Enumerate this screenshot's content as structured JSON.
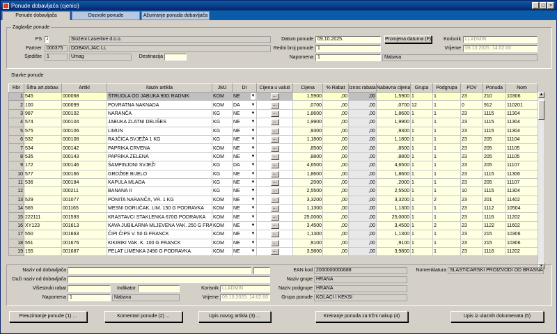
{
  "window": {
    "title": "Ponude dobavljača (cjenici)"
  },
  "tabs": [
    {
      "label": "Ponude dobavljača"
    },
    {
      "label": "Dozvole ponude"
    },
    {
      "label": "Ažuriranje ponuda dobavljača"
    }
  ],
  "header": {
    "section_title": "Zaglavlje ponude",
    "ps_label": "PS",
    "ps_value": "4",
    "ps_name": "Složeni Laserline d.o.o.",
    "partner_label": "Partner",
    "partner_value": "000375",
    "partner_name": "DOBAVLJAČ LL",
    "sjediste_label": "Sjedište",
    "sjediste_value": "1",
    "sjediste_name": "Umag",
    "destinacija_label": "Destinacija",
    "destinacija_value": "",
    "datum_label": "Datum ponude",
    "datum_value": "09.10.2025.",
    "promjena_btn": "Promjena datuma (F)",
    "redni_label": "Redni broj ponude",
    "redni_value": "1",
    "napomena_label": "Napomena",
    "napomena_value": "1",
    "napomena_text": "Nabava",
    "korisnik_label": "Korisnik",
    "korisnik_value": "LLADMIN",
    "vrijeme_label": "Vrijeme",
    "vrijeme_value": "09.10.2025. 14:02:00"
  },
  "stavke": {
    "section_title": "Stavke ponude",
    "columns": [
      "Rbr",
      "Šifra art.dobav.",
      "Artikl",
      "Naziv artikla",
      "JMJ",
      "DI",
      "Cijena u valuti",
      "Cijena",
      "% Rabat",
      "Iznos rabata",
      "Nabavna cijena",
      "Grupa",
      "Podgrupa",
      "PDV",
      "Ponuda",
      "Nom"
    ],
    "rows": [
      {
        "rbr": "1",
        "sifra": "545",
        "artikl": "000068",
        "naziv": "ŠTRUDLA OD JABUKA 90G RADNIK",
        "jmj": "KOM",
        "di": "NE",
        "cijena": "1,5900",
        "rabat": ",00",
        "iznos": ",00",
        "nabavna": "1,5900",
        "grupa": "1",
        "podgrupa": "1",
        "pdv": "23",
        "ponuda": "210",
        "nom": "10306"
      },
      {
        "rbr": "2",
        "sifra": "100",
        "artikl": "000099",
        "naziv": "POVRATNA NAKNADA",
        "jmj": "KOM",
        "di": "DA",
        "cijena": ",0700",
        "rabat": ",00",
        "iznos": ",00",
        "nabavna": ",0700",
        "grupa": "12",
        "podgrupa": "1",
        "pdv": "0",
        "ponuda": "912",
        "nom": "110201"
      },
      {
        "rbr": "3",
        "sifra": "987",
        "artikl": "000102",
        "naziv": "NARANČA",
        "jmj": "KG",
        "di": "NE",
        "cijena": "1,8600",
        "rabat": ",00",
        "iznos": ",00",
        "nabavna": "1,8600",
        "grupa": "1",
        "podgrupa": "1",
        "pdv": "23",
        "ponuda": "1115",
        "nom": "11304"
      },
      {
        "rbr": "4",
        "sifra": "574",
        "artikl": "000104",
        "naziv": "JABUKA ZLATNI DELIŠES",
        "jmj": "KG",
        "di": "NE",
        "cijena": "1,9900",
        "rabat": ",00",
        "iznos": ",00",
        "nabavna": "1,9900",
        "grupa": "1",
        "podgrupa": "1",
        "pdv": "23",
        "ponuda": "1115",
        "nom": "11304"
      },
      {
        "rbr": "5",
        "sifra": "575",
        "artikl": "000106",
        "naziv": "LIMUN",
        "jmj": "KG",
        "di": "NE",
        "cijena": ",9300",
        "rabat": ",00",
        "iznos": ",00",
        "nabavna": ",9300",
        "grupa": "1",
        "podgrupa": "1",
        "pdv": "23",
        "ponuda": "1115",
        "nom": "11304"
      },
      {
        "rbr": "6",
        "sifra": "532",
        "artikl": "000108",
        "naziv": "RAJČICA SVJEŽA 1 KG",
        "jmj": "KG",
        "di": "NE",
        "cijena": "1,1800",
        "rabat": ",00",
        "iznos": ",00",
        "nabavna": "1,1800",
        "grupa": "1",
        "podgrupa": "1",
        "pdv": "23",
        "ponuda": "205",
        "nom": "11104"
      },
      {
        "rbr": "7",
        "sifra": "534",
        "artikl": "000142",
        "naziv": "PAPRIKA CRVENA",
        "jmj": "KOM",
        "di": "NE",
        "cijena": ",8500",
        "rabat": ",00",
        "iznos": ",00",
        "nabavna": ",8500",
        "grupa": "1",
        "podgrupa": "1",
        "pdv": "23",
        "ponuda": "205",
        "nom": "11105"
      },
      {
        "rbr": "8",
        "sifra": "535",
        "artikl": "000143",
        "naziv": "PAPRIKA ZELENA",
        "jmj": "KOM",
        "di": "NE",
        "cijena": ",8800",
        "rabat": ",00",
        "iznos": ",00",
        "nabavna": ",8800",
        "grupa": "1",
        "podgrupa": "1",
        "pdv": "23",
        "ponuda": "205",
        "nom": "11105"
      },
      {
        "rbr": "9",
        "sifra": "172",
        "artikl": "000146",
        "naziv": "ŠAMPINJONI SVJEŽI",
        "jmj": "KG",
        "di": "DA",
        "cijena": "4,6500",
        "rabat": ",00",
        "iznos": ",00",
        "nabavna": "4,6500",
        "grupa": "1",
        "podgrupa": "1",
        "pdv": "23",
        "ponuda": "205",
        "nom": "11107"
      },
      {
        "rbr": "10",
        "sifra": "577",
        "artikl": "000166",
        "naziv": "GROŽĐE BIJELO",
        "jmj": "KG",
        "di": "NE",
        "cijena": "1,8600",
        "rabat": ",00",
        "iznos": ",00",
        "nabavna": "1,8600",
        "grupa": "1",
        "podgrupa": "1",
        "pdv": "23",
        "ponuda": "1115",
        "nom": "11306"
      },
      {
        "rbr": "11",
        "sifra": "536",
        "artikl": "000184",
        "naziv": "KAPULA MLADA",
        "jmj": "KG",
        "di": "NE",
        "cijena": ",2000",
        "rabat": ",00",
        "iznos": ",00",
        "nabavna": ",2000",
        "grupa": "1",
        "podgrupa": "1",
        "pdv": "23",
        "ponuda": "205",
        "nom": "11107"
      },
      {
        "rbr": "12",
        "sifra": "",
        "artikl": "000211",
        "naziv": "BANANA II",
        "jmj": "KG",
        "di": "NE",
        "cijena": "2,5500",
        "rabat": ",00",
        "iznos": ",00",
        "nabavna": "2,5500",
        "grupa": "1",
        "podgrupa": "1",
        "pdv": "10",
        "ponuda": "1115",
        "nom": "11304"
      },
      {
        "rbr": "13",
        "sifra": "529",
        "artikl": "001077",
        "naziv": "PONITA NARANČA, VR. 1 KG",
        "jmj": "KOM",
        "di": "NE",
        "cijena": "3,3200",
        "rabat": ",00",
        "iznos": ",00",
        "nabavna": "3,3200",
        "grupa": "1",
        "podgrupa": "2",
        "pdv": "23",
        "ponuda": "201",
        "nom": "11402"
      },
      {
        "rbr": "14",
        "sifra": "565",
        "artikl": "001165",
        "naziv": "MESNI DORUČAK, LIM. 150 G PODRAVKA",
        "jmj": "KOM",
        "di": "NE",
        "cijena": "1,1300",
        "rabat": ",00",
        "iznos": ",00",
        "nabavna": "1,1300",
        "grupa": "1",
        "podgrupa": "1",
        "pdv": "23",
        "ponuda": "1112",
        "nom": "10504"
      },
      {
        "rbr": "15",
        "sifra": "222111",
        "artikl": "001593",
        "naziv": "KRASTAVCI STAKLENKA 670G PODRAVKA",
        "jmj": "KOM",
        "di": "NE",
        "cijena": "25,0000",
        "rabat": ",00",
        "iznos": ",00",
        "nabavna": "25,0000",
        "grupa": "1",
        "podgrupa": "1",
        "pdv": "23",
        "ponuda": "1116",
        "nom": "11202"
      },
      {
        "rbr": "16",
        "sifra": "XY123",
        "artikl": "001613",
        "naziv": "KAVA JUBILARNA MLJEVENA VAK. 250 G FRANCK",
        "jmj": "KOM",
        "di": "NE",
        "cijena": "3,4500",
        "rabat": ",00",
        "iznos": ",00",
        "nabavna": "3,4500",
        "grupa": "1",
        "podgrupa": "2",
        "pdv": "23",
        "ponuda": "1122",
        "nom": "11602"
      },
      {
        "rbr": "17",
        "sifra": "550",
        "artikl": "001663",
        "naziv": "ČIPI ČIPS V. 50 G FRANCK",
        "jmj": "KOM",
        "di": "NE",
        "cijena": "1,1300",
        "rabat": ",00",
        "iznos": ",00",
        "nabavna": "1,1300",
        "grupa": "1",
        "podgrupa": "1",
        "pdv": "23",
        "ponuda": "215",
        "nom": "10306"
      },
      {
        "rbr": "18",
        "sifra": "551",
        "artikl": "001676",
        "naziv": "KIKIRIKI VAK. K. 100 G FRANCK",
        "jmj": "KOM",
        "di": "NE",
        "cijena": ",9100",
        "rabat": ",00",
        "iznos": ",00",
        "nabavna": ",9100",
        "grupa": "1",
        "podgrupa": "1",
        "pdv": "23",
        "ponuda": "215",
        "nom": "10306"
      },
      {
        "rbr": "19",
        "sifra": "155",
        "artikl": "001687",
        "naziv": "PELAT LIMENKA 2490 G PODRAVKA",
        "jmj": "KOM",
        "di": "NE",
        "cijena": "3,9800",
        "rabat": ",00",
        "iznos": ",00",
        "nabavna": "3,9800",
        "grupa": "1",
        "podgrupa": "1",
        "pdv": "23",
        "ponuda": "1116",
        "nom": "11202"
      }
    ]
  },
  "detail": {
    "naziv_label": "Naziv od dobavljača",
    "naziv_value": "",
    "duzi_label": "Duži naziv od dobavljača",
    "duzi_value": "",
    "visestruki_label": "Višestruki rabat",
    "visestruki_value": "",
    "indikator_label": "Indikator",
    "indikator_value": "",
    "korisnik_label": "Korisnik",
    "korisnik_value": "LLADMIN",
    "napomena_label": "Napomena",
    "napomena_value": "1",
    "napomena_text": "Nabava",
    "vrijeme_label": "Vrijeme",
    "vrijeme_value": "09.10.2025. 14:02:00",
    "ean_label": "EAN kod",
    "ean_value": "2000000000688",
    "naziv_grupe_label": "Naziv grupe",
    "naziv_grupe_value": "HRANA",
    "naziv_podgrupe_label": "Naziv podgrupe",
    "naziv_podgrupe_value": "HRANA",
    "grupa_ponude_label": "Grupa ponude",
    "grupa_ponude_value": "KOLAČI I KEKSI",
    "nomenklatura_label": "Nomenklatura",
    "nomenklatura_value": "SLASTIČARSKI PROIZVODI OD BRAŠNA"
  },
  "buttons": {
    "preuzimanje": "Preuzimanje ponude (1) ...",
    "komentari": "Komentari ponude (2) ...",
    "upis_novog": "Upis novog artikla (3) ...",
    "kreiranje": "Kreiranje ponuda za tržni nakup (4)",
    "upis_ulaznih": "Upis iz ulaznih dokumenata (5)"
  },
  "icons": {
    "dropdown": "▼",
    "ellipsis": "...",
    "scroll_up": "▲",
    "scroll_down": "▼",
    "minimize": "_",
    "maximize": "□",
    "close": "×"
  }
}
